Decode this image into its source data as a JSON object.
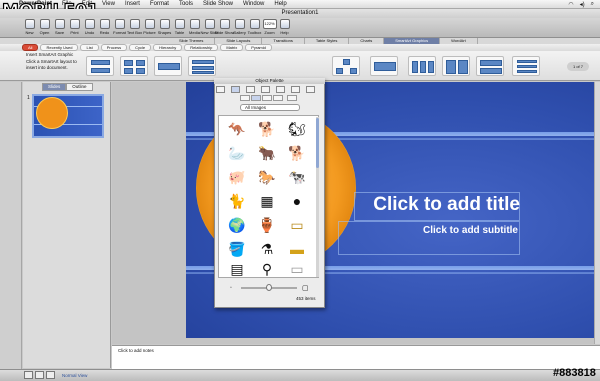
{
  "menubar": {
    "apple": "",
    "app_name": "PowerPoint",
    "items": [
      "File",
      "Edit",
      "View",
      "Insert",
      "Format",
      "Tools",
      "Slide Show",
      "Window",
      "Help"
    ],
    "right_items": [
      "Tue",
      "12:00"
    ]
  },
  "watermark": {
    "logo": "MOBILE01",
    "tag": "#883818"
  },
  "window": {
    "title": "Presentation1"
  },
  "toolbar": {
    "buttons": [
      "New",
      "Open",
      "Save",
      "Print",
      "Undo",
      "Redo",
      "Format",
      "Text Box",
      "Picture",
      "Shapes",
      "Table",
      "Media",
      "New Slide",
      "Slide Show",
      "Gallery",
      "Toolbox",
      "Zoom",
      "Help"
    ],
    "zoom_value": "122%"
  },
  "ribbon": {
    "tabs": [
      "Slide Themes",
      "Slide Layouts",
      "Transitions",
      "Table Styles",
      "Charts",
      "SmartArt Graphics",
      "WordArt"
    ],
    "active_tab": "SmartArt Graphics",
    "subtabs": [
      "All",
      "Recently Used",
      "List",
      "Process",
      "Cycle",
      "Hierarchy",
      "Relationship",
      "Matrix",
      "Pyramid"
    ],
    "active_subtab": "All",
    "insert_label": "Insert SmartArt Graphic",
    "insert_desc": "Click a SmartArt layout to insert into document.",
    "page_indicator": "1 of 7"
  },
  "leftpane": {
    "tabs": [
      "Slides",
      "Outline"
    ],
    "active_tab": "Slides",
    "slide_number": "1"
  },
  "slide": {
    "title": "Click to add title",
    "subtitle": "Click to add subtitle"
  },
  "notes": {
    "placeholder": "Click to add notes"
  },
  "statusbar": {
    "view_label": "Normal View"
  },
  "palette": {
    "title": "Object Palette",
    "filter": "All Images",
    "count": "453 items",
    "items": [
      {
        "name": "kangaroo",
        "glyph": "🦘"
      },
      {
        "name": "dog",
        "glyph": "🐕"
      },
      {
        "name": "squirrel",
        "glyph": "🐿"
      },
      {
        "name": "goose",
        "glyph": "🦢"
      },
      {
        "name": "cow",
        "glyph": "🐂"
      },
      {
        "name": "dog-sitting",
        "glyph": "🐕"
      },
      {
        "name": "pig",
        "glyph": "🐖"
      },
      {
        "name": "horse",
        "glyph": "🐎"
      },
      {
        "name": "cow-spotted",
        "glyph": "🐄"
      },
      {
        "name": "cat",
        "glyph": "🐈"
      },
      {
        "name": "abacus",
        "glyph": "▦"
      },
      {
        "name": "coin",
        "glyph": "●"
      },
      {
        "name": "globe",
        "glyph": "🌍"
      },
      {
        "name": "vase",
        "glyph": "🏺"
      },
      {
        "name": "gift-card",
        "glyph": "▭"
      },
      {
        "name": "watering-can",
        "glyph": "🪣"
      },
      {
        "name": "ink-bottle",
        "glyph": "⚗"
      },
      {
        "name": "gold-bar",
        "glyph": "▬"
      },
      {
        "name": "calculator",
        "glyph": "▤"
      },
      {
        "name": "stool",
        "glyph": "⚲"
      },
      {
        "name": "book",
        "glyph": "▭"
      }
    ]
  }
}
